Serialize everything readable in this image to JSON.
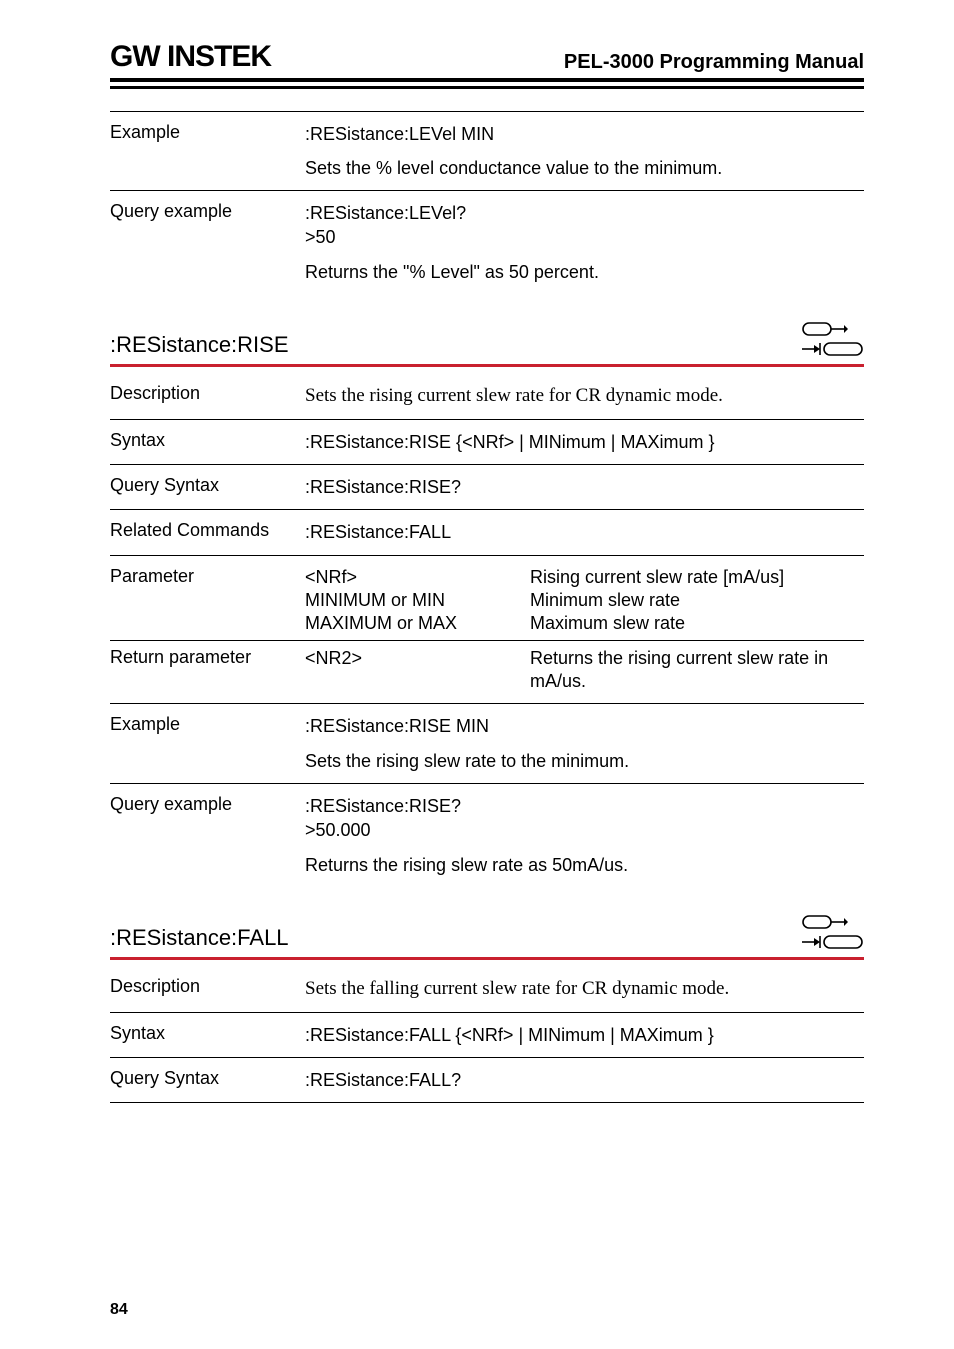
{
  "header": {
    "logo": "GW INSTEK",
    "title": "PEL-3000 Programming Manual"
  },
  "top": {
    "example_label": "Example",
    "example_line1": ":RESistance:LEVel MIN",
    "example_line2": "Sets the % level conductance value to the minimum.",
    "query_label": "Query example",
    "query_line1": ":RESistance:LEVel?",
    "query_line2": ">50",
    "query_line3": "Returns the \"% Level\" as 50 percent."
  },
  "rise": {
    "heading": ":RESistance:RISE",
    "desc_label": "Description",
    "desc_text": "Sets the rising current slew rate for CR dynamic mode.",
    "syntax_label": "Syntax",
    "syntax_text": ":RESistance:RISE {<NRf> | MINimum | MAXimum }",
    "qsyntax_label": "Query Syntax",
    "qsyntax_text": ":RESistance:RISE?",
    "related_label": "Related Commands",
    "related_text": ":RESistance:FALL",
    "param_label": "Parameter",
    "param_rows": [
      {
        "a": "<NRf>",
        "b": "Rising current slew rate [mA/us]"
      },
      {
        "a": "MINIMUM or MIN",
        "b": "Minimum slew rate"
      },
      {
        "a": "MAXIMUM or MAX",
        "b": "Maximum slew rate"
      }
    ],
    "return_label": "Return parameter",
    "return_a": "<NR2>",
    "return_b": "Returns the rising current slew rate in mA/us.",
    "example_label": "Example",
    "example_line1": ":RESistance:RISE MIN",
    "example_line2": "Sets the rising slew rate to the minimum.",
    "query_label": "Query example",
    "query_line1": ":RESistance:RISE?",
    "query_line2": ">50.000",
    "query_line3": "Returns the rising slew rate as 50mA/us."
  },
  "fall": {
    "heading": ":RESistance:FALL",
    "desc_label": "Description",
    "desc_text": "Sets the falling current slew rate for CR dynamic mode.",
    "syntax_label": "Syntax",
    "syntax_text": ":RESistance:FALL {<NRf> | MINimum | MAXimum }",
    "qsyntax_label": "Query Syntax",
    "qsyntax_text": ":RESistance:FALL?"
  },
  "page_number": "84"
}
